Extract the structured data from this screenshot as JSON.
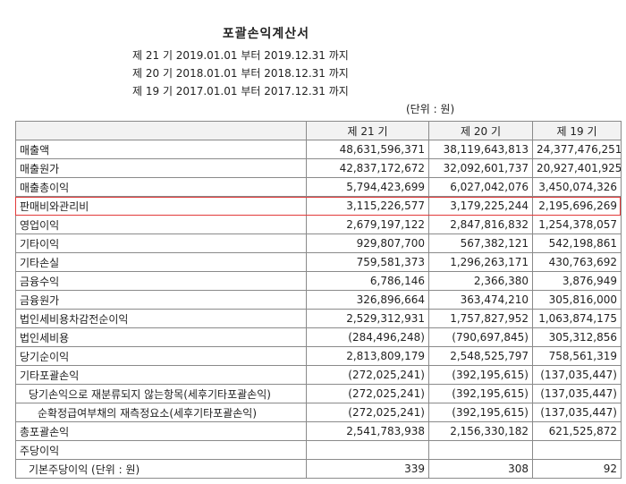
{
  "document": {
    "title": "포괄손익계산서",
    "periods": [
      "제 21 기 2019.01.01 부터 2019.12.31 까지",
      "제 20 기 2018.01.01 부터 2018.12.31 까지",
      "제 19 기 2017.01.01 부터 2017.12.31 까지"
    ],
    "unit": "(단위 : 원)"
  },
  "table": {
    "headers": [
      "",
      "제 21 기",
      "제 20 기",
      "제 19 기"
    ],
    "rows": [
      {
        "label": "매출액",
        "indent": 0,
        "values": [
          "48,631,596,371",
          "38,119,643,813",
          "24,377,476,251"
        ]
      },
      {
        "label": "매출원가",
        "indent": 0,
        "values": [
          "42,837,172,672",
          "32,092,601,737",
          "20,927,401,925"
        ]
      },
      {
        "label": "매출총이익",
        "indent": 0,
        "values": [
          "5,794,423,699",
          "6,027,042,076",
          "3,450,074,326"
        ]
      },
      {
        "label": "판매비와관리비",
        "indent": 0,
        "values": [
          "3,115,226,577",
          "3,179,225,244",
          "2,195,696,269"
        ],
        "highlighted": true
      },
      {
        "label": "영업이익",
        "indent": 0,
        "values": [
          "2,679,197,122",
          "2,847,816,832",
          "1,254,378,057"
        ]
      },
      {
        "label": "기타이익",
        "indent": 0,
        "values": [
          "929,807,700",
          "567,382,121",
          "542,198,861"
        ]
      },
      {
        "label": "기타손실",
        "indent": 0,
        "values": [
          "759,581,373",
          "1,296,263,171",
          "430,763,692"
        ]
      },
      {
        "label": "금융수익",
        "indent": 0,
        "values": [
          "6,786,146",
          "2,366,380",
          "3,876,949"
        ]
      },
      {
        "label": "금융원가",
        "indent": 0,
        "values": [
          "326,896,664",
          "363,474,210",
          "305,816,000"
        ]
      },
      {
        "label": "법인세비용차감전순이익",
        "indent": 0,
        "values": [
          "2,529,312,931",
          "1,757,827,952",
          "1,063,874,175"
        ]
      },
      {
        "label": "법인세비용",
        "indent": 0,
        "values": [
          "(284,496,248)",
          "(790,697,845)",
          "305,312,856"
        ]
      },
      {
        "label": "당기순이익",
        "indent": 0,
        "values": [
          "2,813,809,179",
          "2,548,525,797",
          "758,561,319"
        ]
      },
      {
        "label": "기타포괄손익",
        "indent": 0,
        "values": [
          "(272,025,241)",
          "(392,195,615)",
          "(137,035,447)"
        ]
      },
      {
        "label": "당기손익으로 재분류되지 않는항목(세후기타포괄손익)",
        "indent": 1,
        "values": [
          "(272,025,241)",
          "(392,195,615)",
          "(137,035,447)"
        ]
      },
      {
        "label": "순확정급여부채의 재측정요소(세후기타포괄손익)",
        "indent": 2,
        "values": [
          "(272,025,241)",
          "(392,195,615)",
          "(137,035,447)"
        ]
      },
      {
        "label": "총포괄손익",
        "indent": 0,
        "values": [
          "2,541,783,938",
          "2,156,330,182",
          "621,525,872"
        ]
      },
      {
        "label": "주당이익",
        "indent": 0,
        "values": [
          "",
          "",
          ""
        ]
      },
      {
        "label": "기본주당이익 (단위 : 원)",
        "indent": 1,
        "values": [
          "339",
          "308",
          "92"
        ]
      }
    ]
  },
  "colors": {
    "highlight_border": "#e23a3a",
    "header_bg": "#f2f2f2",
    "grid": "#8a8a8a"
  }
}
